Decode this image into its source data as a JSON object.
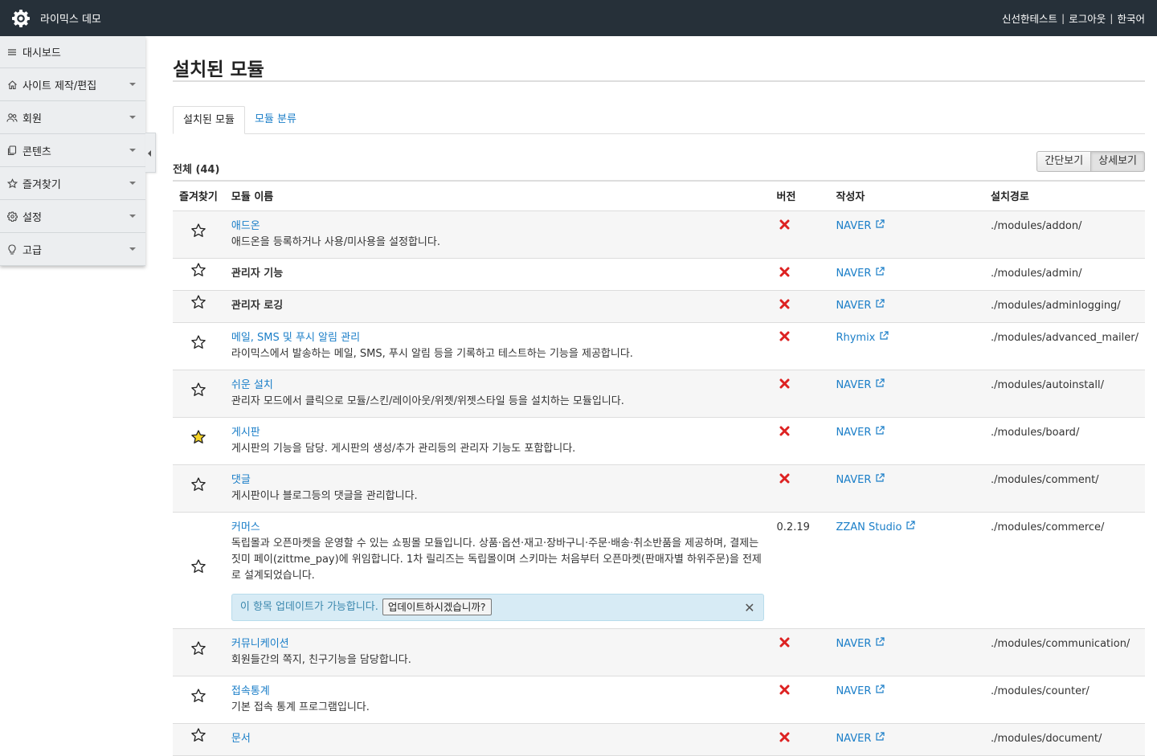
{
  "header": {
    "title": "라이믹스 데모",
    "user": "신선한테스트",
    "logout": "로그아웃",
    "language": "한국어",
    "separator": "|"
  },
  "sidebar": {
    "items": [
      {
        "label": "대시보드",
        "icon": "list-icon"
      },
      {
        "label": "사이트 제작/편집",
        "icon": "home-icon"
      },
      {
        "label": "회원",
        "icon": "users-icon"
      },
      {
        "label": "콘텐츠",
        "icon": "copy-icon"
      },
      {
        "label": "즐겨찾기",
        "icon": "star-icon"
      },
      {
        "label": "설정",
        "icon": "gear-icon"
      },
      {
        "label": "고급",
        "icon": "lightbulb-icon"
      }
    ]
  },
  "page": {
    "title": "설치된 모듈",
    "tabs": [
      "설치된 모듈",
      "모듈 분류"
    ],
    "total": "전체 (44)",
    "view_simple": "간단보기",
    "view_detail": "상세보기"
  },
  "table": {
    "headers": [
      "즐겨찾기",
      "모듈 이름",
      "버전",
      "작성자",
      "설치경로"
    ],
    "rows": [
      {
        "name": "애드온",
        "desc": "애드온을 등록하거나 사용/미사용을 설정합니다.",
        "link": true,
        "version": "",
        "author": "NAVER",
        "path": "./modules/addon/",
        "fav": false
      },
      {
        "name": "관리자 기능",
        "desc": "",
        "link": false,
        "version": "",
        "author": "NAVER",
        "path": "./modules/admin/",
        "fav": false
      },
      {
        "name": "관리자 로깅",
        "desc": "",
        "link": false,
        "version": "",
        "author": "NAVER",
        "path": "./modules/adminlogging/",
        "fav": false
      },
      {
        "name": "메일, SMS 및 푸시 알림 관리",
        "desc": "라이믹스에서 발송하는 메일, SMS, 푸시 알림 등을 기록하고 테스트하는 기능을 제공합니다.",
        "link": true,
        "version": "",
        "author": "Rhymix",
        "path": "./modules/advanced_mailer/",
        "fav": false
      },
      {
        "name": "쉬운 설치",
        "desc": "관리자 모드에서 클릭으로 모듈/스킨/레이아웃/위젯/위젯스타일 등을 설치하는 모듈입니다.",
        "link": true,
        "version": "",
        "author": "NAVER",
        "path": "./modules/autoinstall/",
        "fav": false
      },
      {
        "name": "게시판",
        "desc": "게시판의 기능을 담당. 게시판의 생성/추가 관리등의 관리자 기능도 포함합니다.",
        "link": true,
        "version": "",
        "author": "NAVER",
        "path": "./modules/board/",
        "fav": true
      },
      {
        "name": "댓글",
        "desc": "게시판이나 블로그등의 댓글을 관리합니다.",
        "link": true,
        "version": "",
        "author": "NAVER",
        "path": "./modules/comment/",
        "fav": false
      },
      {
        "name": "커머스",
        "desc": "독립몰과 오픈마켓을 운영할 수 있는 쇼핑몰 모듈입니다. 상품·옵션·재고·장바구니·주문·배송·취소반품을 제공하며, 결제는 짓미 페이(zittme_pay)에 위임합니다. 1차 릴리즈는 독립몰이며 스키마는 처음부터 오픈마켓(판매자별 하위주문)을 전제로 설계되었습니다.",
        "link": true,
        "version": "0.2.19",
        "author": "ZZAN Studio",
        "path": "./modules/commerce/",
        "fav": false,
        "update": {
          "text": "이 항목 업데이트가 가능합니다.",
          "button": "업데이트하시겠습니까?",
          "close": "✕"
        }
      },
      {
        "name": "커뮤니케이션",
        "desc": "회원들간의 쪽지, 친구기능을 담당합니다.",
        "link": true,
        "version": "",
        "author": "NAVER",
        "path": "./modules/communication/",
        "fav": false
      },
      {
        "name": "접속통계",
        "desc": "기본 접속 통계 프로그램입니다.",
        "link": true,
        "version": "",
        "author": "NAVER",
        "path": "./modules/counter/",
        "fav": false
      },
      {
        "name": "문서",
        "desc": "",
        "link": true,
        "version": "",
        "author": "NAVER",
        "path": "./modules/document/",
        "fav": false
      }
    ]
  },
  "colors": {
    "header_bg": "#263039",
    "link": "#1a7ec8",
    "error_mark": "#dd2222",
    "favorite_star": "#f5d327"
  }
}
